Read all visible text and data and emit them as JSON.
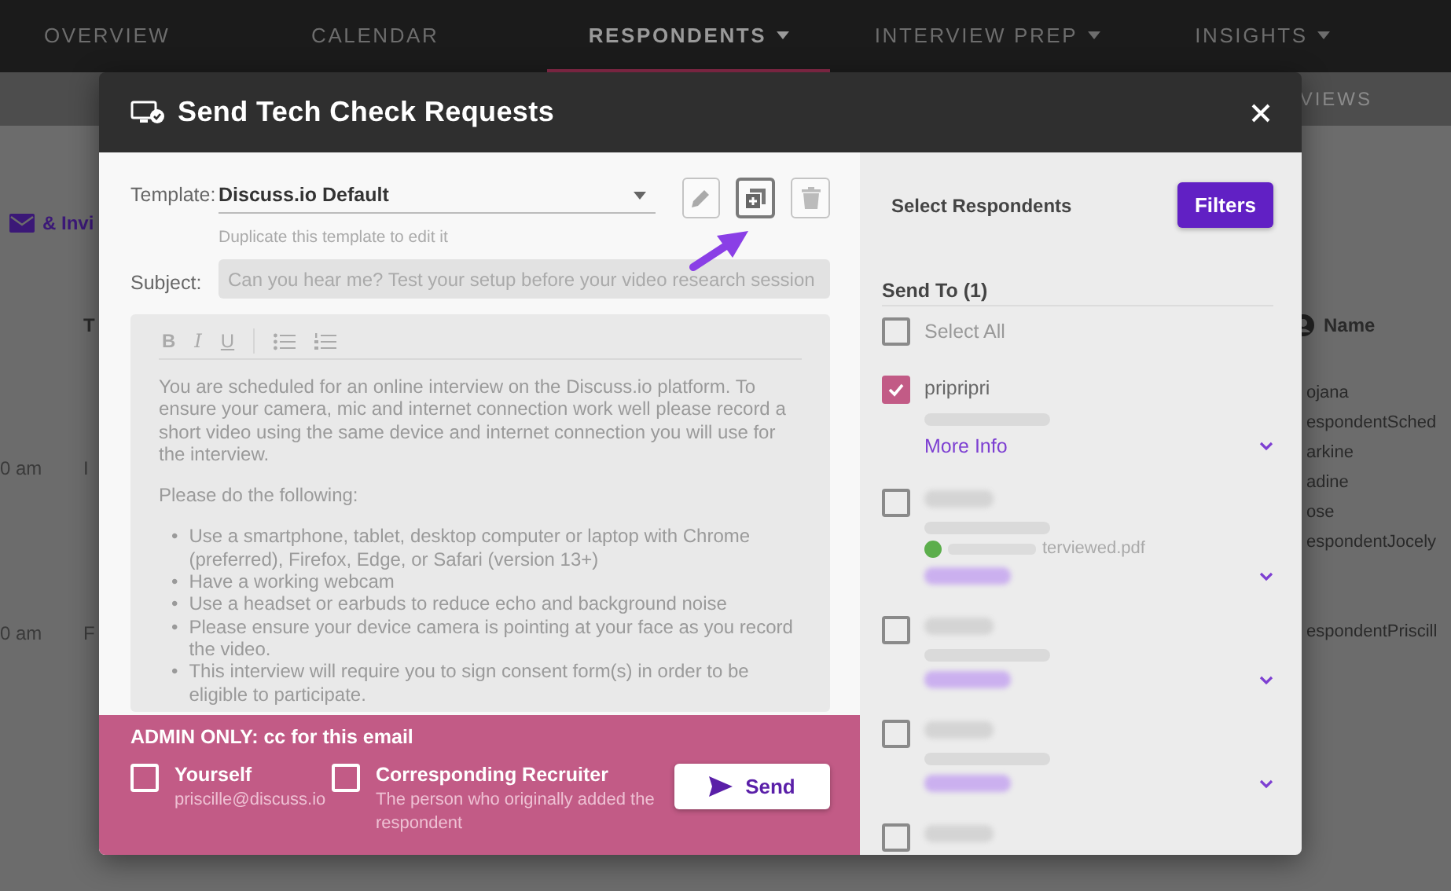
{
  "nav": {
    "tabs": [
      {
        "label": "OVERVIEW",
        "selected": false,
        "dropdown": false
      },
      {
        "label": "CALENDAR",
        "selected": false,
        "dropdown": false
      },
      {
        "label": "RESPONDENTS",
        "selected": true,
        "dropdown": true
      },
      {
        "label": "INTERVIEW PREP",
        "selected": false,
        "dropdown": true
      },
      {
        "label": "INSIGHTS",
        "selected": false,
        "dropdown": true
      }
    ]
  },
  "background": {
    "subbar_text": "VIEWS",
    "invite_link": "& Invi",
    "column_1": "T",
    "column_2": "Name",
    "left_rows": [
      {
        "time": "0 am",
        "type": "I"
      },
      {
        "time": "0 am",
        "type": "F"
      }
    ],
    "names": [
      "ojana",
      "espondentSched",
      "arkine",
      "adine",
      "ose",
      "espondentJocely",
      "espondentPriscill"
    ]
  },
  "modal": {
    "title": "Send Tech Check Requests",
    "template": {
      "label": "Template:",
      "value": "Discuss.io Default",
      "hint": "Duplicate this template to edit it"
    },
    "subject": {
      "label": "Subject:",
      "value": "Can you hear me? Test your setup before your video research session",
      "disabled": true
    },
    "editor": {
      "toolbar": [
        "B",
        "I",
        "U"
      ],
      "bullet_marker": "•",
      "paragraphs": [
        "You are scheduled for an online interview on the Discuss.io platform. To ensure your camera, mic and internet connection work well please record a short video using the same device and internet connection you will use for the interview.",
        "Please do the following:"
      ],
      "bullets": [
        "Use a smartphone, tablet, desktop computer or laptop with Chrome (preferred), Firefox, Edge, or Safari (version 13+)",
        "Have a working webcam",
        "Use a headset or earbuds to reduce echo and background noise",
        "Please ensure your device camera is pointing at your face as you record the video.",
        "This interview will require you to sign consent form(s) in order to be eligible to participate."
      ]
    },
    "admin": {
      "title": "ADMIN ONLY: cc for this email",
      "options": [
        {
          "label": "Yourself",
          "detail": "priscille@discuss.io",
          "checked": false
        },
        {
          "label": "Corresponding Recruiter",
          "detail": "The person who originally added the respondent",
          "checked": false
        }
      ],
      "send": "Send"
    },
    "respondents_panel": {
      "title": "Select Respondents",
      "filters": "Filters",
      "send_to": "Send To (1)",
      "select_all": {
        "label": "Select All",
        "checked": false
      },
      "respondents": [
        {
          "kind": "clear",
          "name": "pripripri",
          "checked": true,
          "more_info": "More Info"
        },
        {
          "kind": "blurred",
          "checked": false,
          "attachment": "terviewed.pdf",
          "more_info_shown": true
        },
        {
          "kind": "blurred",
          "checked": false,
          "more_info_shown": true
        },
        {
          "kind": "blurred",
          "checked": false,
          "more_info_shown": true
        },
        {
          "kind": "blurred",
          "checked": false,
          "more_info_shown": false
        }
      ]
    }
  }
}
